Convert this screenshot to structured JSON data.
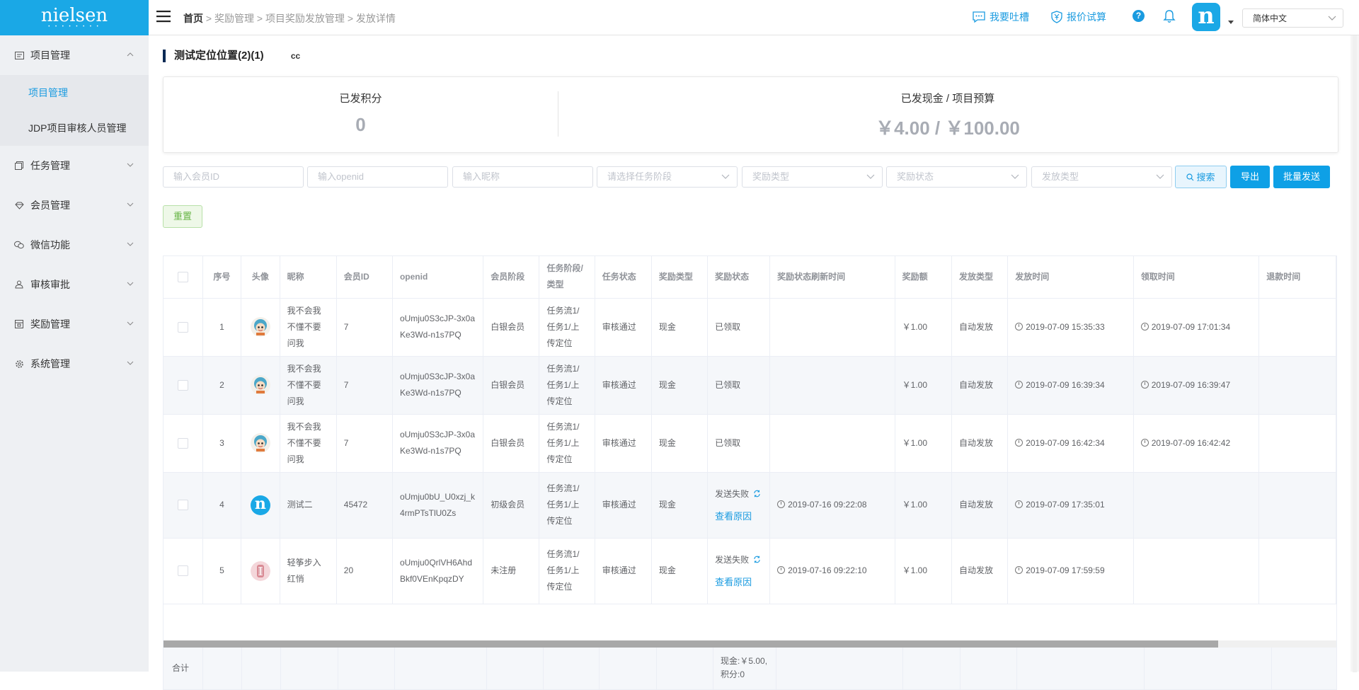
{
  "app": {
    "logo": "nielsen",
    "logo_dots": "• • • • • • • •"
  },
  "sidebar": {
    "groups": [
      {
        "label": "项目管理",
        "icon": "project-icon",
        "expanded": true,
        "children": [
          "项目管理",
          "JDP项目审核人员管理"
        ]
      },
      {
        "label": "任务管理",
        "icon": "task-icon"
      },
      {
        "label": "会员管理",
        "icon": "member-icon"
      },
      {
        "label": "微信功能",
        "icon": "wechat-icon"
      },
      {
        "label": "审核审批",
        "icon": "audit-icon"
      },
      {
        "label": "奖励管理",
        "icon": "reward-icon"
      },
      {
        "label": "系统管理",
        "icon": "settings-icon"
      }
    ]
  },
  "topbar": {
    "breadcrumb": [
      "首页",
      "奖励管理",
      "项目奖励发放管理",
      "发放详情"
    ],
    "feedback_label": "我要吐槽",
    "quote_label": "报价试算",
    "help": "?",
    "avatar_letter": "n",
    "language": "简体中文"
  },
  "page": {
    "title": "测试定位位置(2)(1)",
    "subtitle": "cc"
  },
  "stats": {
    "points_label": "已发积分",
    "points_value": "0",
    "cash_label": "已发现金 / 项目预算",
    "cash_value": "￥4.00 / ￥100.00"
  },
  "filters": {
    "member_id": "输入会员ID",
    "openid": "输入openid",
    "nickname": "输入昵称",
    "stage": "请选择任务阶段",
    "reward_type": "奖励类型",
    "reward_status": "奖励状态",
    "send_type": "发放类型",
    "search": "搜索",
    "export": "导出",
    "batch_send": "批量发送",
    "reset": "重置"
  },
  "table": {
    "headers": [
      "序号",
      "头像",
      "昵称",
      "会员ID",
      "openid",
      "会员阶段",
      "任务阶段/类型",
      "任务状态",
      "奖励类型",
      "奖励状态",
      "奖励状态刷新时间",
      "奖励额",
      "发放类型",
      "发放时间",
      "领取时间",
      "退款时间"
    ],
    "rows": [
      {
        "no": "1",
        "avatar": "cartoon",
        "nickname": "我不会我不懂不要问我",
        "member_id": "7",
        "openid": "oUmju0S3cJP-3x0aKe3Wd-n1s7PQ",
        "stage": "白银会员",
        "task": "任务流1/任务1/上传定位",
        "task_status": "审核通过",
        "reward_type": "现金",
        "reward_status": "已领取",
        "refresh_time": "",
        "amount": "￥1.00",
        "send_type": "自动发放",
        "send_time": "2019-07-09 15:35:33",
        "receive_time": "2019-07-09 17:01:34",
        "refund_time": ""
      },
      {
        "no": "2",
        "avatar": "cartoon",
        "nickname": "我不会我不懂不要问我",
        "member_id": "7",
        "openid": "oUmju0S3cJP-3x0aKe3Wd-n1s7PQ",
        "stage": "白银会员",
        "task": "任务流1/任务1/上传定位",
        "task_status": "审核通过",
        "reward_type": "现金",
        "reward_status": "已领取",
        "refresh_time": "",
        "amount": "￥1.00",
        "send_type": "自动发放",
        "send_time": "2019-07-09 16:39:34",
        "receive_time": "2019-07-09 16:39:47",
        "refund_time": ""
      },
      {
        "no": "3",
        "avatar": "cartoon",
        "nickname": "我不会我不懂不要问我",
        "member_id": "7",
        "openid": "oUmju0S3cJP-3x0aKe3Wd-n1s7PQ",
        "stage": "白银会员",
        "task": "任务流1/任务1/上传定位",
        "task_status": "审核通过",
        "reward_type": "现金",
        "reward_status": "已领取",
        "refresh_time": "",
        "amount": "￥1.00",
        "send_type": "自动发放",
        "send_time": "2019-07-09 16:42:34",
        "receive_time": "2019-07-09 16:42:42",
        "refund_time": ""
      },
      {
        "no": "4",
        "avatar": "nielsen",
        "nickname": "测试二",
        "member_id": "45472",
        "openid": "oUmju0bU_U0xzj_k4rmPTsTlU0Zs",
        "stage": "初级会员",
        "task": "任务流1/任务1/上传定位",
        "task_status": "审核通过",
        "reward_type": "现金",
        "reward_status": "发送失败",
        "reason_link": "查看原因",
        "refresh_time": "2019-07-16 09:22:08",
        "amount": "￥1.00",
        "send_type": "自动发放",
        "send_time": "2019-07-09 17:35:01",
        "receive_time": "",
        "refund_time": ""
      },
      {
        "no": "5",
        "avatar": "pink",
        "nickname": "轻筝步入红悄",
        "member_id": "20",
        "openid": "oUmju0QrlVH6AhdBkf0VEnKpqzDY",
        "stage": "未注册",
        "task": "任务流1/任务1/上传定位",
        "task_status": "审核通过",
        "reward_type": "现金",
        "reward_status": "发送失败",
        "reason_link": "查看原因",
        "refresh_time": "2019-07-16 09:22:10",
        "amount": "￥1.00",
        "send_type": "自动发放",
        "send_time": "2019-07-09 17:59:59",
        "receive_time": "",
        "refund_time": ""
      }
    ],
    "footer_label": "合计",
    "footer_total_line1": "现金:￥5.00,",
    "footer_total_line2": "积分:0"
  },
  "colors": {
    "brand": "#1aa8e6",
    "link": "#1a9be0",
    "sidebar_bg": "#eef0f3",
    "title_bar": "#0b2a55"
  }
}
